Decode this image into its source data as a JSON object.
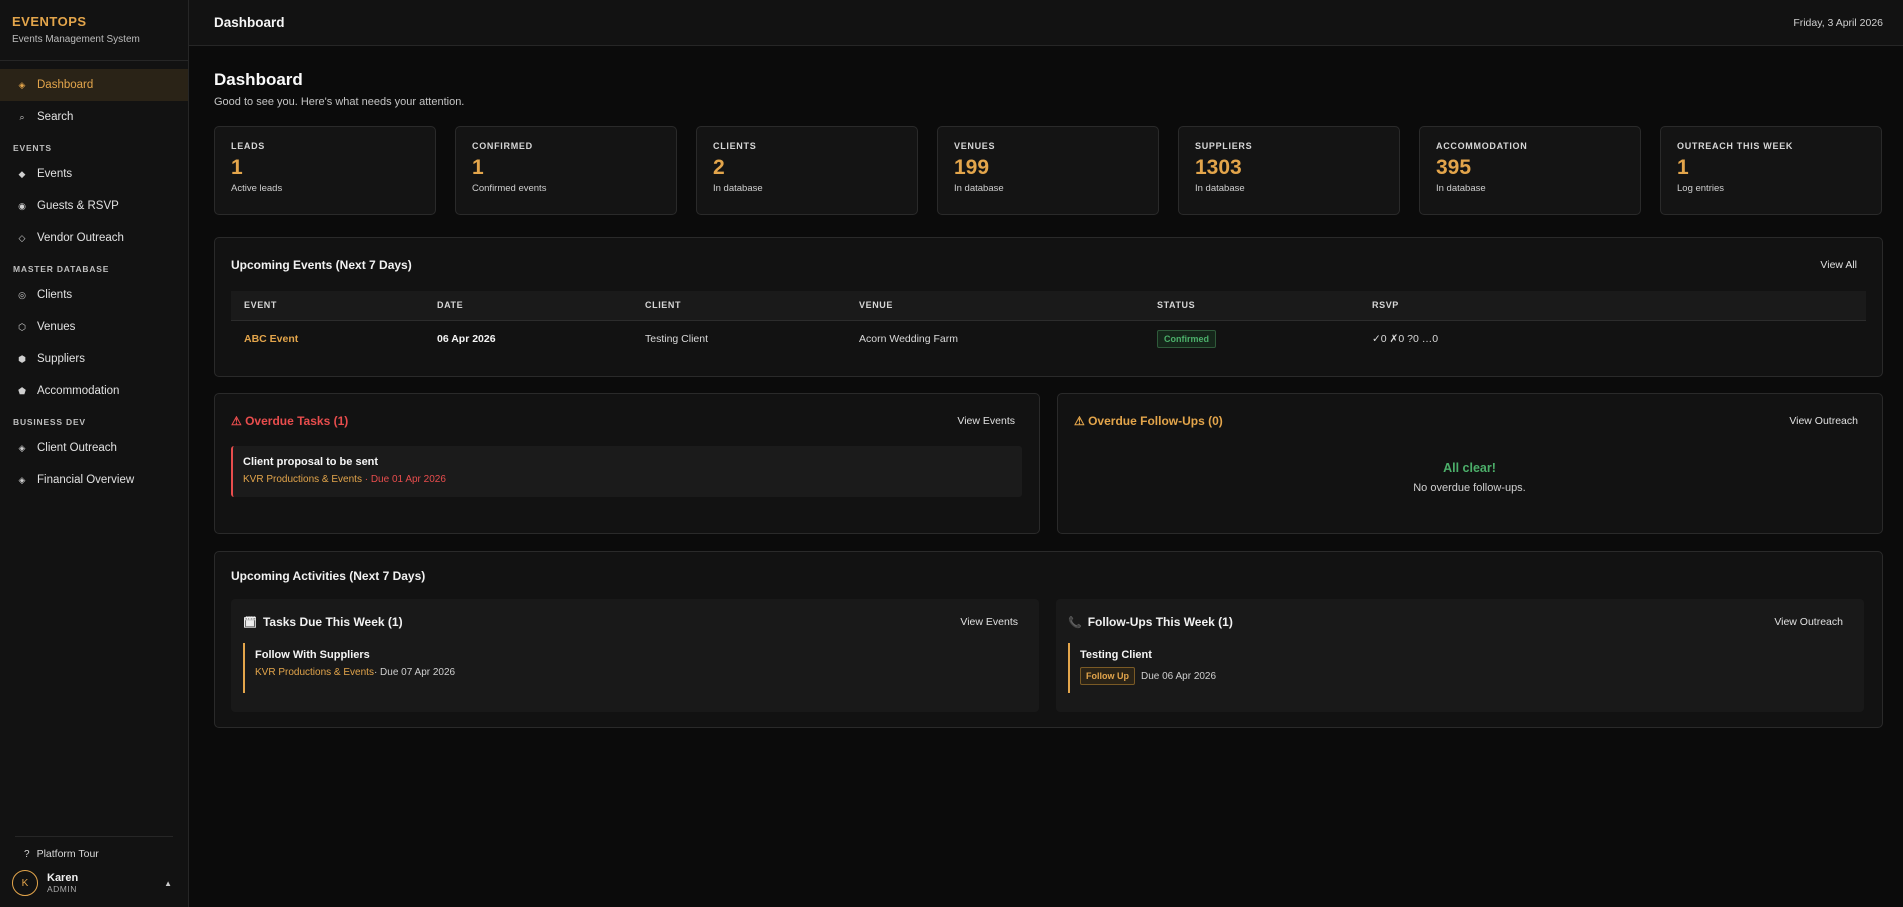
{
  "brand": {
    "name": "EVENTOPS",
    "subtitle": "Events Management System"
  },
  "nav": {
    "top": [
      {
        "label": "Dashboard",
        "icon": "diamond-dot-icon",
        "glyph": "◈",
        "active": true
      },
      {
        "label": "Search",
        "icon": "search-icon",
        "glyph": "⌕"
      }
    ],
    "sections": [
      {
        "title": "EVENTS",
        "items": [
          {
            "label": "Events",
            "icon": "diamond-icon",
            "glyph": "◆"
          },
          {
            "label": "Guests & RSVP",
            "icon": "radio-icon",
            "glyph": "◉"
          },
          {
            "label": "Vendor Outreach",
            "icon": "diamond-outline-icon",
            "glyph": "◇"
          }
        ]
      },
      {
        "title": "MASTER DATABASE",
        "items": [
          {
            "label": "Clients",
            "icon": "target-icon",
            "glyph": "◎"
          },
          {
            "label": "Venues",
            "icon": "hexagon-outline-icon",
            "glyph": "⬡"
          },
          {
            "label": "Suppliers",
            "icon": "hexagon-icon",
            "glyph": "⬢"
          },
          {
            "label": "Accommodation",
            "icon": "house-icon",
            "glyph": "⬟"
          }
        ]
      },
      {
        "title": "BUSINESS DEV",
        "items": [
          {
            "label": "Client Outreach",
            "icon": "diamond-dot-icon",
            "glyph": "◈"
          },
          {
            "label": "Financial Overview",
            "icon": "diamond-dot-icon",
            "glyph": "◈"
          }
        ]
      }
    ]
  },
  "footer": {
    "tour": "Platform Tour",
    "tour_glyph": "?",
    "user": {
      "initial": "K",
      "name": "Karen",
      "role": "ADMIN",
      "caret": "▲"
    }
  },
  "topbar": {
    "title": "Dashboard",
    "date": "Friday, 3 April 2026"
  },
  "header": {
    "title": "Dashboard",
    "subtitle": "Good to see you. Here's what needs your attention."
  },
  "stats": [
    {
      "label": "LEADS",
      "value": "1",
      "sub": "Active leads"
    },
    {
      "label": "CONFIRMED",
      "value": "1",
      "sub": "Confirmed events"
    },
    {
      "label": "CLIENTS",
      "value": "2",
      "sub": "In database"
    },
    {
      "label": "VENUES",
      "value": "199",
      "sub": "In database"
    },
    {
      "label": "SUPPLIERS",
      "value": "1303",
      "sub": "In database"
    },
    {
      "label": "ACCOMMODATION",
      "value": "395",
      "sub": "In database"
    },
    {
      "label": "OUTREACH THIS WEEK",
      "value": "1",
      "sub": "Log entries"
    }
  ],
  "upcoming_events": {
    "title": "Upcoming Events (Next 7 Days)",
    "view_all": "View All",
    "columns": [
      "EVENT",
      "DATE",
      "CLIENT",
      "VENUE",
      "STATUS",
      "RSVP"
    ],
    "rows": [
      {
        "event": "ABC Event",
        "date": "06 Apr 2026",
        "client": "Testing Client",
        "venue": "Acorn Wedding Farm",
        "status": "Confirmed",
        "rsvp": "✓0 ✗0 ?0 …0"
      }
    ]
  },
  "overdue_tasks": {
    "title": "⚠ Overdue Tasks (1)",
    "link": "View Events",
    "items": [
      {
        "title": "Client proposal to be sent",
        "org": "KVR Productions & Events",
        "due": " · Due 01 Apr 2026"
      }
    ]
  },
  "overdue_followups": {
    "title": "⚠ Overdue Follow-Ups (0)",
    "link": "View Outreach",
    "empty_title": "All clear!",
    "empty_sub": "No overdue follow-ups."
  },
  "activities": {
    "title": "Upcoming Activities (Next 7 Days)",
    "tasks": {
      "title": "Tasks Due This Week (1)",
      "glyph": "🗓",
      "link": "View Events",
      "items": [
        {
          "title": "Follow With Suppliers",
          "org": "KVR Productions & Events",
          "due": " · Due 07 Apr 2026"
        }
      ]
    },
    "followups": {
      "title": "Follow-Ups This Week (1)",
      "glyph": "📞",
      "link": "View Outreach",
      "items": [
        {
          "title": "Testing Client",
          "badge": "Follow Up",
          "due": "Due 06 Apr 2026"
        }
      ]
    }
  },
  "colors": {
    "accent": "#e3a54b",
    "danger": "#e84d4d",
    "success": "#4caf6a",
    "background": "#0b0b0b",
    "panel": "#121212"
  }
}
